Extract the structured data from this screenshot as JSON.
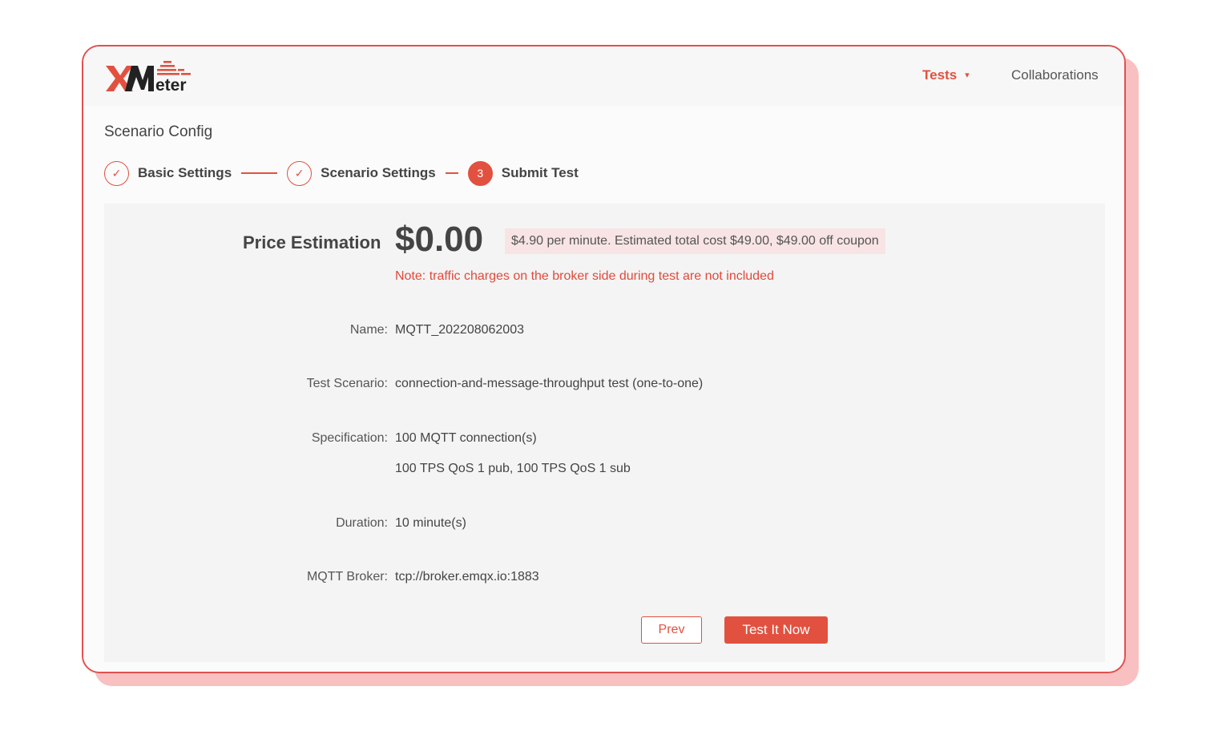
{
  "header": {
    "logo_text": "XMeter",
    "nav": {
      "tests_label": "Tests",
      "collaborations_label": "Collaborations"
    }
  },
  "page": {
    "title": "Scenario Config"
  },
  "steps": [
    {
      "label": "Basic Settings",
      "state": "done",
      "marker": "✓"
    },
    {
      "label": "Scenario Settings",
      "state": "done",
      "marker": "✓"
    },
    {
      "label": "Submit Test",
      "state": "active",
      "marker": "3"
    }
  ],
  "price": {
    "label": "Price Estimation",
    "value": "$0.00",
    "detail": "$4.90 per minute. Estimated total cost $49.00, $49.00 off coupon",
    "note": "Note: traffic charges on the broker side during test are not included"
  },
  "summary": {
    "name_label": "Name:",
    "name_value": "MQTT_202208062003",
    "scenario_label": "Test Scenario:",
    "scenario_value": "connection-and-message-throughput test (one-to-one)",
    "spec_label": "Specification:",
    "spec_value_1": "100 MQTT connection(s)",
    "spec_value_2": "100 TPS QoS 1 pub, 100 TPS QoS 1 sub",
    "duration_label": "Duration:",
    "duration_value": "10 minute(s)",
    "broker_label": "MQTT Broker:",
    "broker_value": "tcp://broker.emqx.io:1883"
  },
  "actions": {
    "prev_label": "Prev",
    "test_now_label": "Test It Now"
  },
  "colors": {
    "accent": "#e2513f",
    "border": "#e25050",
    "shadow": "#f8c0c0",
    "price_detail_bg": "#f8e4e4"
  }
}
